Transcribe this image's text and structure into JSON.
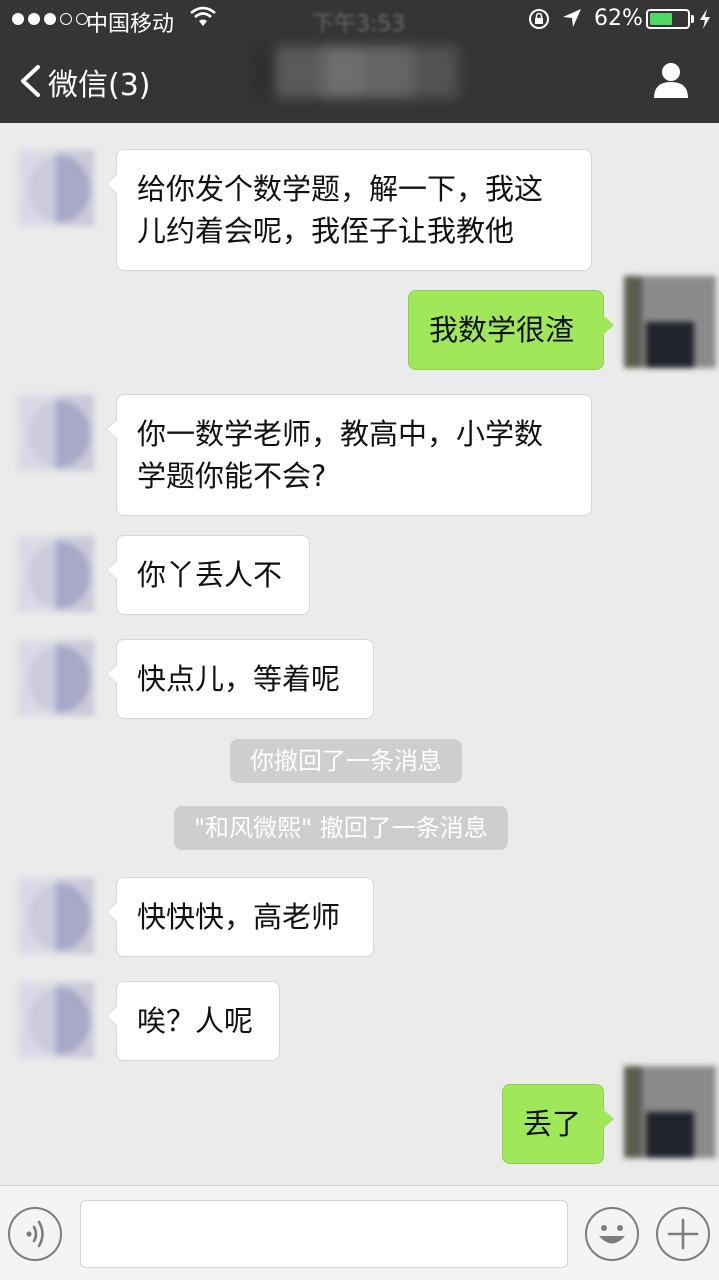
{
  "status_bar": {
    "carrier": "中国移动",
    "time": "下午3:53",
    "battery_percent": "62%",
    "battery_level": 0.62,
    "battery_color": "#4cd964"
  },
  "nav": {
    "back_label": "微信(3)",
    "back_icon": "chevron-left-icon",
    "profile_icon": "person-icon"
  },
  "messages": [
    {
      "side": "in",
      "text": "给你发个数学题，解一下，我这儿约着会呢，我侄子让我教他"
    },
    {
      "side": "out",
      "text": "我数学很渣"
    },
    {
      "side": "in",
      "text": "你一数学老师，教高中，小学数学题你能不会?"
    },
    {
      "side": "in",
      "text": "你丫丢人不"
    },
    {
      "side": "in",
      "text": "快点儿，等着呢"
    },
    {
      "side": "system",
      "text": "你撤回了一条消息"
    },
    {
      "side": "system",
      "text": "\"和风微熙\" 撤回了一条消息"
    },
    {
      "side": "in",
      "text": "快快快，高老师"
    },
    {
      "side": "in",
      "text": "唉？人呢"
    },
    {
      "side": "out",
      "text": "丢了"
    }
  ],
  "input_bar": {
    "voice_icon": "voice-icon",
    "emoji_icon": "emoji-icon",
    "more_icon": "plus-icon",
    "text_value": ""
  },
  "colors": {
    "nav_background": "#353535",
    "chat_background": "#ebebeb",
    "outgoing_bubble": "#a0e75a",
    "incoming_bubble": "#ffffff",
    "system_notice": "#cecece"
  }
}
